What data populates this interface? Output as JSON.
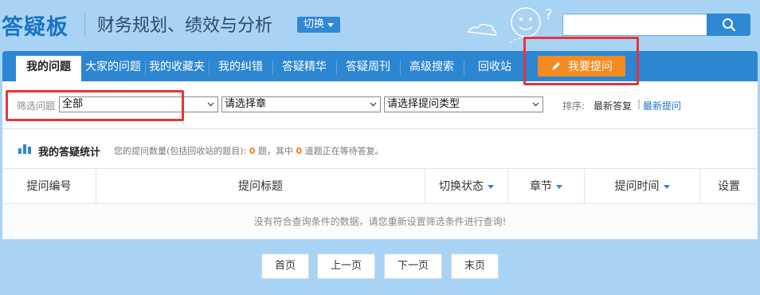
{
  "header": {
    "brand": "答疑板",
    "subject": "财务规划、绩效与分析",
    "switch_label": "切换",
    "search_placeholder": "",
    "search_icon": "search-icon"
  },
  "nav": {
    "items": [
      {
        "label": "我的问题",
        "active": true
      },
      {
        "label": "大家的问题"
      },
      {
        "label": "我的收藏夹"
      },
      {
        "label": "我的纠错"
      },
      {
        "label": "答疑精华"
      },
      {
        "label": "答疑周刊"
      },
      {
        "label": "高级搜索"
      },
      {
        "label": "回收站"
      }
    ],
    "ask_button": "我要提问"
  },
  "filter": {
    "label": "筛选问题",
    "scope_value": "全部",
    "chapter_value": "请选择章",
    "type_value": "请选择提问类型",
    "sort_label": "排序:",
    "sort_latest_answer": "最新答复",
    "sort_latest_question": "最新提问"
  },
  "stats": {
    "title": "我的答疑统计",
    "desc_prefix": "您的提问数量(包括回收站的题目):",
    "question_count": "0",
    "desc_middle": "题，其中",
    "waiting_count": "0",
    "desc_suffix": "道题正在等待答复。"
  },
  "table": {
    "columns": [
      "提问编号",
      "提问标题",
      "切换状态",
      "章节",
      "提问时间",
      "设置"
    ],
    "empty_message": "没有符合查询条件的数据，请您重新设置筛选条件进行查询!"
  },
  "pager": {
    "first": "首页",
    "prev": "上一页",
    "next": "下一页",
    "last": "末页"
  },
  "colors": {
    "background": "#a9d3f5",
    "nav": "#2d86d2",
    "accent_orange": "#f58a1f",
    "highlight_red": "#e8333b",
    "link_blue": "#1a73c4"
  }
}
